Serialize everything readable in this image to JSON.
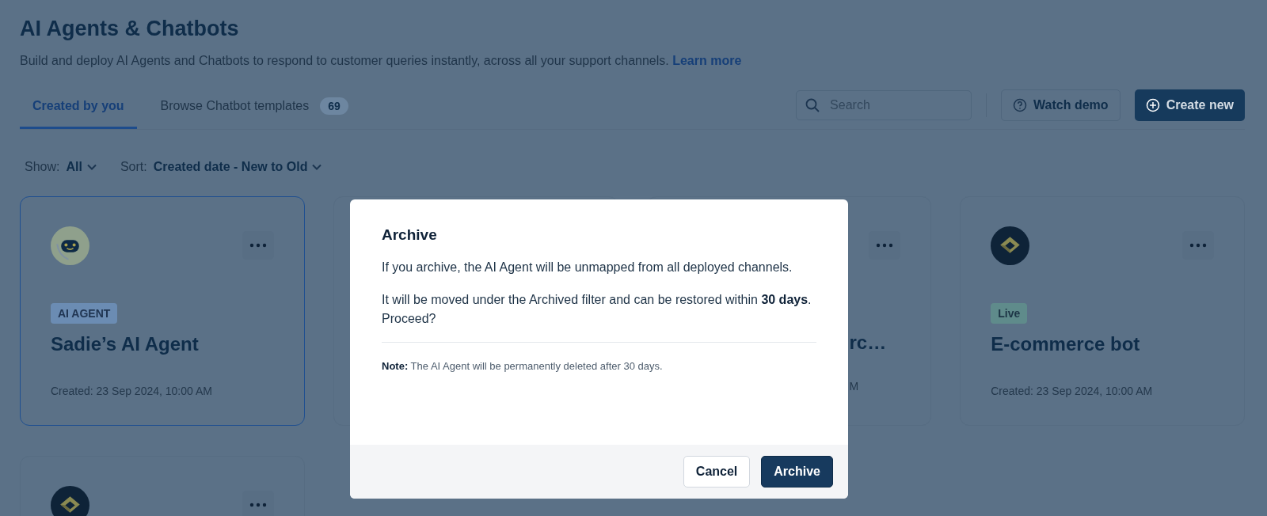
{
  "header": {
    "title": "AI Agents & Chatbots",
    "subtitle": "Build and deploy AI Agents and Chatbots to respond to customer queries instantly, across all your support channels.",
    "link": "Learn more"
  },
  "tabs": [
    {
      "label": "Created by you",
      "selected": true
    },
    {
      "label": "Browse Chatbot templates",
      "count": "69",
      "selected": false
    }
  ],
  "search": {
    "placeholder": "Search"
  },
  "actions": {
    "demo": "Watch demo",
    "create": "Create new"
  },
  "filters": [
    {
      "label": "Show:",
      "value": "All"
    },
    {
      "label": "Sort:",
      "value": "Created date - New to Old"
    }
  ],
  "cards": [
    {
      "kind": "full",
      "selected": true,
      "badge": {
        "text": "AI AGENT",
        "color": "#6b8cb3"
      },
      "name": "Sadie’s AI Agent",
      "created": "Created: 23 Sep 2024, 10:00 AM"
    },
    {
      "kind": "covered",
      "selected": false
    },
    {
      "kind": "partial",
      "selected": false,
      "name": "rc…",
      "created": "M"
    },
    {
      "kind": "full",
      "selected": false,
      "badge": {
        "text": "Live",
        "color": "#5f8b8b"
      },
      "name": "E-commerce bot",
      "created": "Created: 23 Sep 2024, 10:00 AM"
    },
    {
      "kind": "stub",
      "selected": false
    }
  ],
  "dialog": {
    "title": "Archive",
    "paragraphs": [
      "If you archive, the AI Agent will be unmapped from all deployed channels.",
      "It will be moved under the Archived filter and can be restored within **30 days**. Proceed?"
    ],
    "note": "**Note:** The AI Agent will be permanently deleted after 30 days.",
    "cancel": "Cancel",
    "confirm": "Archive"
  }
}
